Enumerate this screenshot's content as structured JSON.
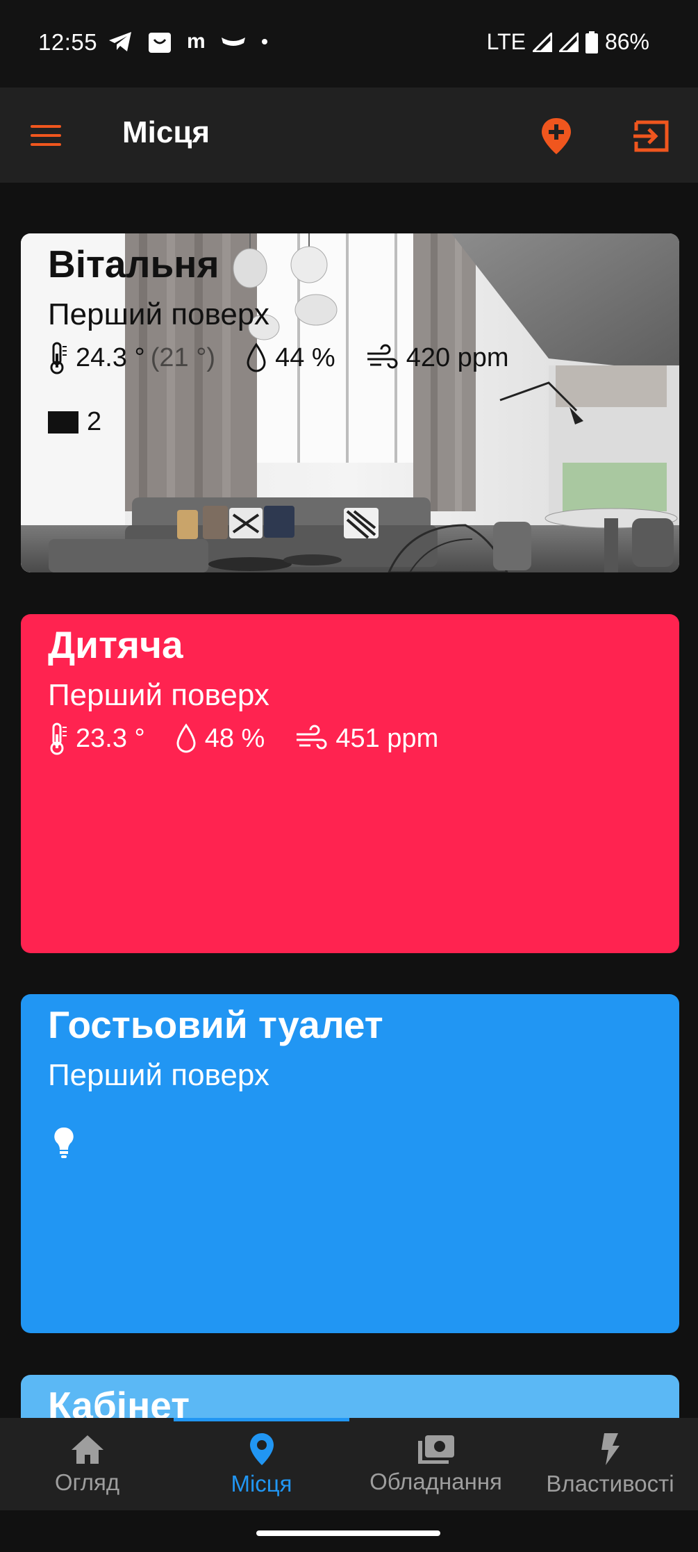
{
  "status_bar": {
    "time": "12:55",
    "network": "LTE",
    "battery": "86%",
    "notification_icons": [
      "telegram-icon",
      "shopping-bag-icon",
      "m-app-icon",
      "mask-icon",
      "dot-icon"
    ],
    "m_letter": "m"
  },
  "app_bar": {
    "title": "Місця",
    "menu_icon": "menu-icon",
    "add_place_icon": "add-location-icon",
    "logout_icon": "logout-icon",
    "accent": "#F0561E"
  },
  "rooms": [
    {
      "name": "Вітальня",
      "floor": "Перший поверх",
      "temperature": "24.3 °",
      "target_temperature": "(21 °)",
      "humidity": "44 %",
      "co2": "420 ppm",
      "blinds_count": "2",
      "background": "photo"
    },
    {
      "name": "Дитяча",
      "floor": "Перший поверх",
      "temperature": "23.3 °",
      "humidity": "48 %",
      "co2": "451 ppm",
      "color": "#FF2350"
    },
    {
      "name": "Гостьовий туалет",
      "floor": "Перший поверх",
      "device_icon": "lightbulb-icon",
      "color": "#2196F3"
    },
    {
      "name": "Кабінет",
      "color": "#5BB8F5"
    }
  ],
  "bottom_nav": {
    "items": [
      {
        "label": "Огляд",
        "icon": "home-icon"
      },
      {
        "label": "Місця",
        "icon": "location-pin-icon",
        "active": true
      },
      {
        "label": "Обладнання",
        "icon": "devices-icon"
      },
      {
        "label": "Властивості",
        "icon": "lightning-icon"
      }
    ],
    "active_color": "#2196F3",
    "inactive_color": "#9E9E9E"
  }
}
